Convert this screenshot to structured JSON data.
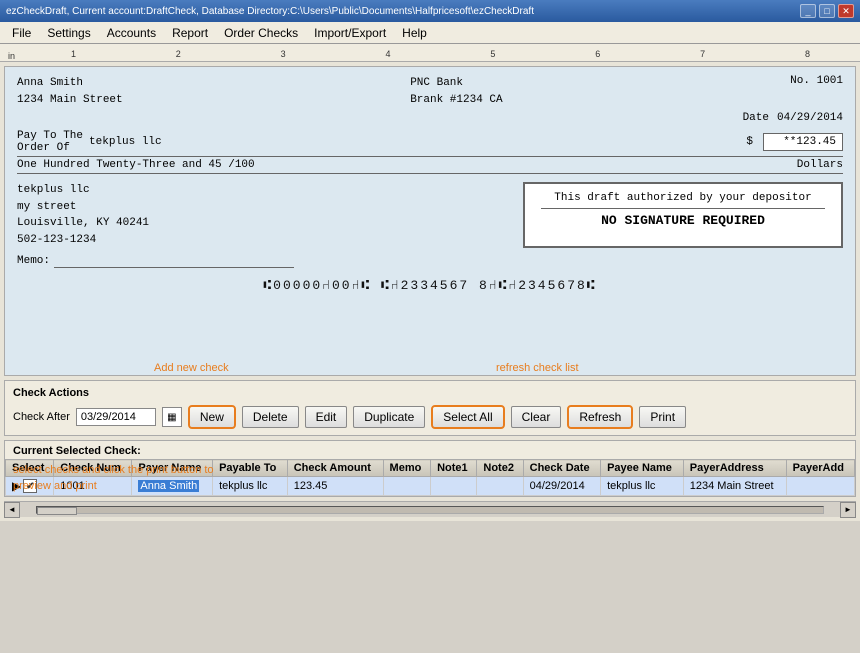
{
  "window": {
    "title": "ezCheckDraft, Current account:DraftCheck, Database Directory:C:\\Users\\Public\\Documents\\Halfpricesoft\\ezCheckDraft",
    "title_short": "ezCheckDraft, Current account:DraftCheck, Database Directory:C:\\Users\\Public\\Documents\\Halfpricesoft\\ezCheckDraft"
  },
  "menu": {
    "items": [
      "File",
      "Settings",
      "Accounts",
      "Report",
      "Order Checks",
      "Import/Export",
      "Help"
    ]
  },
  "ruler": {
    "label": "in",
    "marks": [
      "1",
      "2",
      "3",
      "4",
      "5",
      "6",
      "7",
      "8"
    ]
  },
  "check": {
    "sender_name": "Anna Smith",
    "sender_address": "1234 Main Street",
    "bank_name": "PNC Bank",
    "bank_branch": "Brank #1234 CA",
    "check_no_label": "No.",
    "check_no": "1001",
    "date_label": "Date",
    "date": "04/29/2014",
    "payto_label": "Pay To The",
    "order_label": "Order Of",
    "payee": "tekplus llc",
    "dollar_sign": "$",
    "amount": "**123.45",
    "written_amount": "One Hundred  Twenty-Three  and 45 /100",
    "dollars_label": "Dollars",
    "payee_addr_name": "tekplus llc",
    "payee_addr_street": "my street",
    "payee_addr_city": "Louisville, KY 40241",
    "payee_addr_phone": "502-123-1234",
    "nosig_line1": "This draft authorized by your depositor",
    "nosig_line2": "NO SIGNATURE REQUIRED",
    "memo_label": "Memo:",
    "micr": "⑆00000⑁00⑁⑆  ⑆⑁2334567 8⑁⑆⑁2345678⑆"
  },
  "actions": {
    "title": "Check Actions",
    "check_after_label": "Check After",
    "check_after_value": "03/29/2014",
    "buttons": {
      "new": "New",
      "delete": "Delete",
      "edit": "Edit",
      "duplicate": "Duplicate",
      "select_all": "Select All",
      "clear": "Clear",
      "refresh": "Refresh",
      "print": "Print"
    },
    "tooltip_new": "Add new check",
    "tooltip_refresh": "refresh check list"
  },
  "table": {
    "title": "Current Selected Check:",
    "columns": [
      "Select",
      "Check Num",
      "Payer Name",
      "Payable To",
      "Check Amount",
      "Memo",
      "Note1",
      "Note2",
      "Check Date",
      "Payee Name",
      "PayerAddress",
      "PayerAdd"
    ],
    "rows": [
      {
        "selected": true,
        "arrow": true,
        "check_num": "1001",
        "payer_name": "Anna Smith",
        "payable_to": "tekplus llc",
        "check_amount": "123.45",
        "memo": "",
        "note1": "",
        "note2": "",
        "check_date": "04/29/2014",
        "payee_name": "tekplus llc",
        "payer_address": "1234 Main Street",
        "payer_add2": ""
      }
    ]
  },
  "annotations": {
    "new_check": "Add new check",
    "refresh_list": "refresh check list",
    "select_print": "select checks and click the print button to\npreview and print"
  }
}
